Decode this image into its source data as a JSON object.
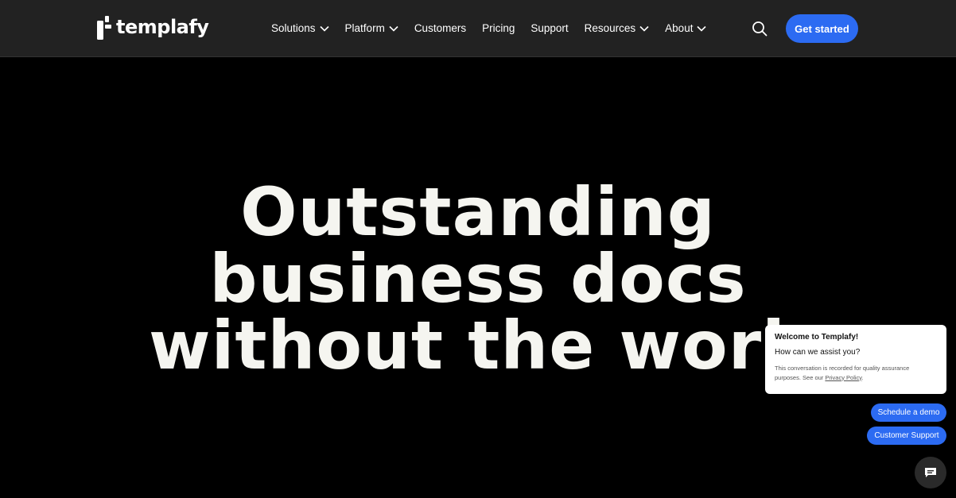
{
  "header": {
    "logo_text": "templafy",
    "nav": [
      {
        "label": "Solutions",
        "has_dropdown": true
      },
      {
        "label": "Platform",
        "has_dropdown": true
      },
      {
        "label": "Customers",
        "has_dropdown": false
      },
      {
        "label": "Pricing",
        "has_dropdown": false
      },
      {
        "label": "Support",
        "has_dropdown": false
      },
      {
        "label": "Resources",
        "has_dropdown": true
      },
      {
        "label": "About",
        "has_dropdown": true
      }
    ],
    "search_icon": "search-icon",
    "cta_label": "Get started"
  },
  "hero": {
    "lines": [
      "Outstanding",
      "business docs",
      "without the work"
    ]
  },
  "chat": {
    "welcome": "Welcome to Templafy!",
    "question": "How can we assist you?",
    "disclaimer_prefix": "This conversation is recorded for quality assurance purposes. See our ",
    "privacy_link": "Privacy Policy",
    "disclaimer_suffix": ".",
    "chips": [
      "Schedule a demo",
      "Customer Support"
    ],
    "launcher_icon": "chat-bubble-icon"
  },
  "colors": {
    "header_bg": "#222222",
    "page_bg": "#000000",
    "accent": "#2c6bf2",
    "hero_text": "#f5f5f0"
  }
}
